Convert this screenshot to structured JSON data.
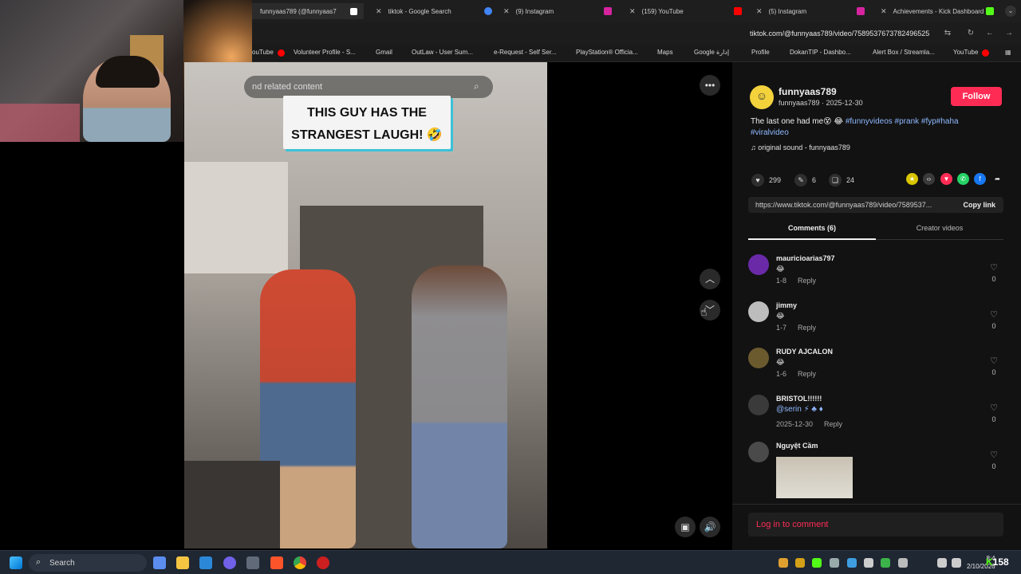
{
  "browser": {
    "tabs": [
      {
        "label": "funnyaas789 (@funnyaas7",
        "fav_color": "#ffffff"
      },
      {
        "label": "tiktok - Google Search",
        "fav_color": "#4285f4"
      },
      {
        "label": "(9) Instagram",
        "fav_color": "#d6249f"
      },
      {
        "label": "(159) YouTube",
        "fav_color": "#ff0000"
      },
      {
        "label": "(5) Instagram",
        "fav_color": "#d6249f"
      },
      {
        "label": "Achievements - Kick Dashboard",
        "fav_color": "#53fc18"
      }
    ],
    "url": "tiktok.com/@funnyaas789/video/7589537673782496525",
    "bookmarks": [
      "ouTube",
      "Volunteer Profile - S...",
      "Gmail",
      "OutLaw - User Sum...",
      "e-Request - Self Ser...",
      "PlayStation® Officia...",
      "Maps",
      "Google إدارة",
      "Profile",
      "DokanTIP - Dashbo...",
      "Alert Box / Streamla...",
      "YouTube"
    ]
  },
  "video": {
    "search_placeholder": "nd related content",
    "caption": "THIS GUY HAS THE STRANGEST LAUGH! 🤣"
  },
  "post": {
    "username": "funnyaas789",
    "subline": "funnyaas789 · 2025-12-30",
    "follow_label": "Follow",
    "desc_text": "The last one had me😵 😂",
    "hashtags": "#funnyvideos #prank #fyp#haha #viralvideo",
    "sound": "original sound - funnyaas789",
    "likes": "299",
    "comments_count": "6",
    "saves": "24",
    "link": "https://www.tiktok.com/@funnyaas789/video/7589537...",
    "copy_label": "Copy link",
    "tab_comments": "Comments (6)",
    "tab_creator": "Creator videos"
  },
  "comments": [
    {
      "name": "mauricioarias797",
      "body": "😂",
      "date": "1-8",
      "reply": "Reply",
      "likes": "0",
      "color": "#6a2aa8"
    },
    {
      "name": "jimmy",
      "body": "😂",
      "date": "1-7",
      "reply": "Reply",
      "likes": "0",
      "color": "#bdbdbd"
    },
    {
      "name": "RUDY AJCALON",
      "body": "😂",
      "date": "1-6",
      "reply": "Reply",
      "likes": "0",
      "color": "#6b5a2e"
    },
    {
      "name": "BRISTOL!!!!!!",
      "body": "@serin ⚡ ♣ ♦",
      "date": "2025-12-30",
      "reply": "Reply",
      "likes": "0",
      "color": "#3a3a3a"
    },
    {
      "name": "Nguyệt Cầm",
      "body": "",
      "date": "",
      "reply": "",
      "likes": "0",
      "color": "#4a4a4a"
    }
  ],
  "login_text": "Log in to comment",
  "taskbar": {
    "search_label": "Search",
    "time": "8:4",
    "date": "2/10/2026",
    "badge": "158"
  }
}
